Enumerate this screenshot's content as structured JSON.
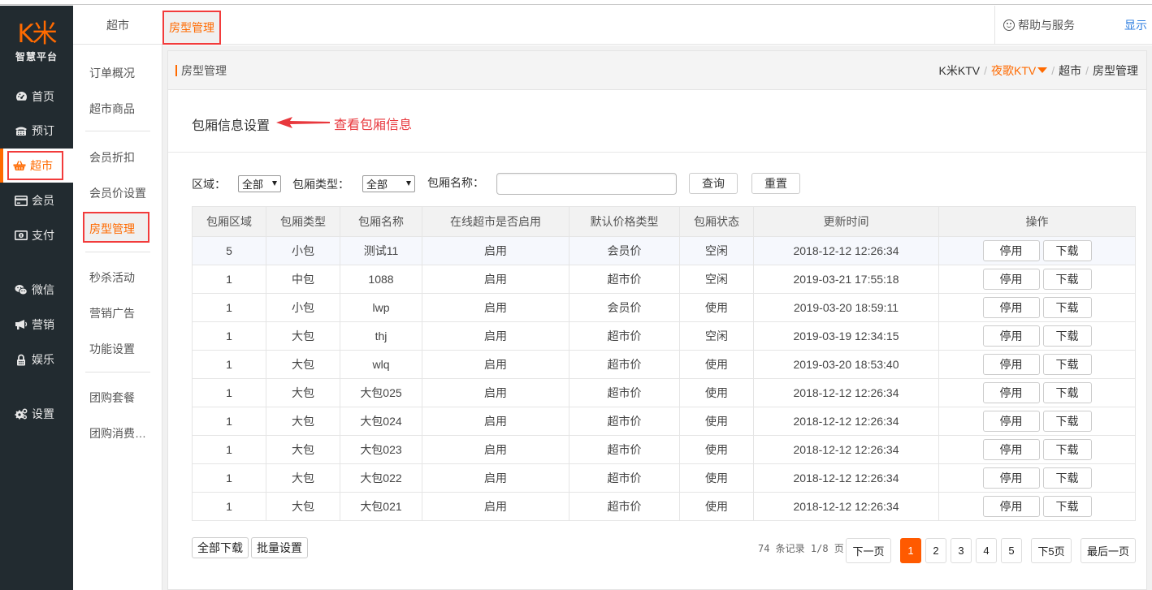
{
  "logo": {
    "mark": "K米",
    "subtitle": "智慧平台"
  },
  "sidebar": {
    "items": [
      {
        "label": "首页",
        "icon": "dashboard-icon"
      },
      {
        "label": "预订",
        "icon": "phone-icon"
      },
      {
        "label": "超市",
        "icon": "basket-icon",
        "active": true
      },
      {
        "label": "会员",
        "icon": "card-icon"
      },
      {
        "label": "支付",
        "icon": "money-icon"
      },
      {
        "label": "微信",
        "icon": "wechat-icon"
      },
      {
        "label": "营销",
        "icon": "bullhorn-icon"
      },
      {
        "label": "娱乐",
        "icon": "lock-icon"
      },
      {
        "label": "设置",
        "icon": "gears-icon"
      }
    ]
  },
  "subnav": {
    "items": [
      {
        "label": "订单概况"
      },
      {
        "label": "超市商品"
      },
      {
        "label": "会员折扣"
      },
      {
        "label": "会员价设置"
      },
      {
        "label": "房型管理",
        "active": true
      },
      {
        "label": "秒杀活动"
      },
      {
        "label": "营销广告"
      },
      {
        "label": "功能设置"
      },
      {
        "label": "团购套餐"
      },
      {
        "label": "团购消费…"
      }
    ]
  },
  "topbar": {
    "tabs": [
      {
        "label": "超市"
      },
      {
        "label": "房型管理",
        "active": true
      }
    ],
    "help": "帮助与服务",
    "show": "显示"
  },
  "page": {
    "header_title": "房型管理",
    "breadcrumb": [
      "K米KTV",
      "夜歌KTV",
      "超市",
      "房型管理"
    ],
    "section_title": "包厢信息设置",
    "annotation": "查看包厢信息",
    "accent_color": "#ff6a00",
    "annotation_color": "#e8383d"
  },
  "filters": {
    "area_label": "区域：",
    "area_value": "全部",
    "type_label": "包厢类型：",
    "type_value": "全部",
    "name_label": "包厢名称：",
    "name_value": "",
    "query": "查询",
    "reset": "重置"
  },
  "table": {
    "columns": [
      "包厢区域",
      "包厢类型",
      "包厢名称",
      "在线超市是否启用",
      "默认价格类型",
      "包厢状态",
      "更新时间",
      "操作"
    ],
    "action_stop": "停用",
    "action_download": "下载",
    "rows": [
      {
        "area": "5",
        "type": "小包",
        "name": "测试11",
        "online": "启用",
        "price": "会员价",
        "status": "空闲",
        "updated": "2018-12-12 12:26:34"
      },
      {
        "area": "1",
        "type": "中包",
        "name": "1088",
        "online": "启用",
        "price": "超市价",
        "status": "空闲",
        "updated": "2019-03-21 17:55:18"
      },
      {
        "area": "1",
        "type": "小包",
        "name": "lwp",
        "online": "启用",
        "price": "会员价",
        "status": "使用",
        "updated": "2019-03-20 18:59:11"
      },
      {
        "area": "1",
        "type": "大包",
        "name": "thj",
        "online": "启用",
        "price": "超市价",
        "status": "空闲",
        "updated": "2019-03-19 12:34:15"
      },
      {
        "area": "1",
        "type": "大包",
        "name": "wlq",
        "online": "启用",
        "price": "超市价",
        "status": "使用",
        "updated": "2019-03-20 18:53:40"
      },
      {
        "area": "1",
        "type": "大包",
        "name": "大包025",
        "online": "启用",
        "price": "超市价",
        "status": "使用",
        "updated": "2018-12-12 12:26:34"
      },
      {
        "area": "1",
        "type": "大包",
        "name": "大包024",
        "online": "启用",
        "price": "超市价",
        "status": "使用",
        "updated": "2018-12-12 12:26:34"
      },
      {
        "area": "1",
        "type": "大包",
        "name": "大包023",
        "online": "启用",
        "price": "超市价",
        "status": "使用",
        "updated": "2018-12-12 12:26:34"
      },
      {
        "area": "1",
        "type": "大包",
        "name": "大包022",
        "online": "启用",
        "price": "超市价",
        "status": "使用",
        "updated": "2018-12-12 12:26:34"
      },
      {
        "area": "1",
        "type": "大包",
        "name": "大包021",
        "online": "启用",
        "price": "超市价",
        "status": "使用",
        "updated": "2018-12-12 12:26:34"
      }
    ]
  },
  "footer": {
    "download_all": "全部下载",
    "batch_set": "批量设置",
    "records_info": "74 条记录 1/8 页",
    "next_page": "下一页",
    "pages": [
      "1",
      "2",
      "3",
      "4",
      "5"
    ],
    "current_page": "1",
    "next5": "下5页",
    "last_page": "最后一页"
  }
}
